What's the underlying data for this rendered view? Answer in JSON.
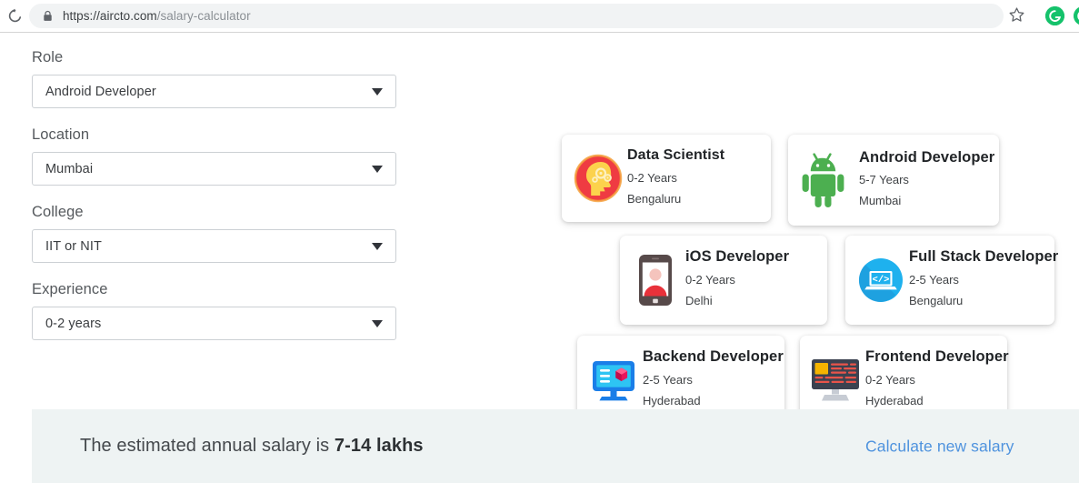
{
  "browser": {
    "reload_icon": "reload-icon",
    "lock_icon": "lock-icon",
    "url_host": "https://aircto.com",
    "url_path": "/salary-calculator",
    "star_icon": "star-bookmark-icon",
    "extension_grammarly": "grammarly-extension-icon",
    "extension_grammarly_letter": "G",
    "extension_partial": "extension-icon-partial"
  },
  "form": {
    "fields": [
      {
        "label": "Role",
        "value": "Android Developer",
        "caret_icon": "chevron-down-icon",
        "name": "role"
      },
      {
        "label": "Location",
        "value": "Mumbai",
        "caret_icon": "chevron-down-icon",
        "name": "location"
      },
      {
        "label": "College",
        "value": "IIT or NIT",
        "caret_icon": "chevron-down-icon",
        "name": "college"
      },
      {
        "label": "Experience",
        "value": "0-2 years",
        "caret_icon": "chevron-down-icon",
        "name": "experience"
      }
    ]
  },
  "role_cards": [
    {
      "title": "Data Scientist",
      "experience": "0-2 Years",
      "location": "Bengaluru",
      "icon": "data-scientist-brain-icon",
      "accent": "#ee3d48"
    },
    {
      "title": "Android Developer",
      "experience": "5-7 Years",
      "location": "Mumbai",
      "icon": "android-robot-icon",
      "accent": "#4caf50"
    },
    {
      "title": "iOS Developer",
      "experience": "0-2 Years",
      "location": "Delhi",
      "icon": "ios-phone-user-icon",
      "accent": "#574a4a"
    },
    {
      "title": "Full Stack Developer",
      "experience": "2-5 Years",
      "location": "Bengaluru",
      "icon": "full-stack-laptop-code-icon",
      "accent": "#20a3e8"
    },
    {
      "title": "Backend Developer",
      "experience": "2-5 Years",
      "location": "Hyderabad",
      "icon": "backend-monitor-cube-icon",
      "accent": "#1a7ee8"
    },
    {
      "title": "Frontend Developer",
      "experience": "0-2 Years",
      "location": "Hyderabad",
      "icon": "frontend-monitor-code-icon",
      "accent": "#3b4250"
    }
  ],
  "salary_banner": {
    "prefix": "The estimated annual salary is ",
    "amount": "7-14 lakhs",
    "link_label": "Calculate new salary",
    "background": "#eef3f3",
    "link_color": "#4f93de"
  }
}
